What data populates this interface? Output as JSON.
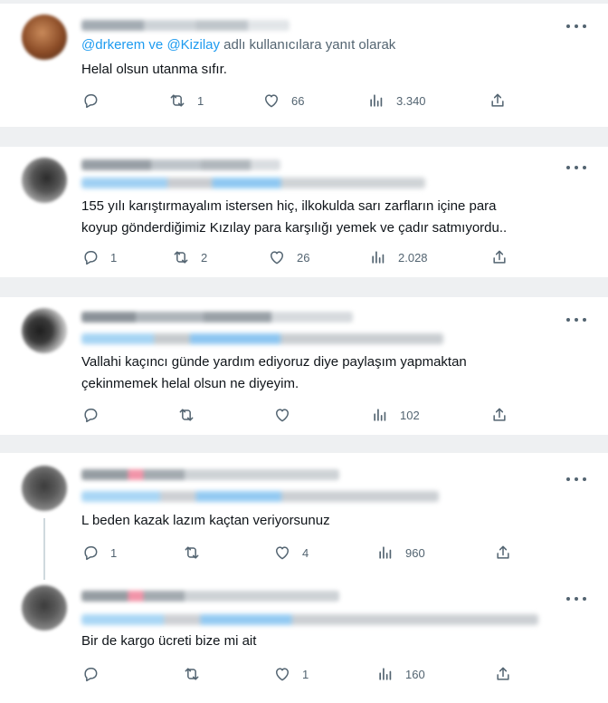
{
  "tweets": [
    {
      "reply_prefix_mention1": "@drkerem",
      "reply_and": " ve ",
      "reply_prefix_mention2": "@Kizilay",
      "reply_suffix": " adlı kullanıcılara yanıt olarak",
      "text_lines": [
        "Helal olsun utanma sıfır."
      ],
      "reply_count": "",
      "retweet_count": "1",
      "like_count": "66",
      "view_count": "3.340"
    },
    {
      "text_lines": [
        "155 yılı karıştırmayalım istersen hiç, ilkokulda sarı zarfların içine para",
        "koyup gönderdiğimiz Kızılay para karşılığı yemek ve çadır satmıyordu.."
      ],
      "reply_count": "1",
      "retweet_count": "2",
      "like_count": "26",
      "view_count": "2.028"
    },
    {
      "text_lines": [
        "Vallahi kaçıncı günde yardım ediyoruz diye paylaşım yapmaktan",
        "çekinmemek helal olsun ne diyeyim."
      ],
      "reply_count": "",
      "retweet_count": "",
      "like_count": "",
      "view_count": "102"
    },
    {
      "text_lines": [
        "L beden kazak lazım kaçtan veriyorsunuz"
      ],
      "reply_count": "1",
      "retweet_count": "",
      "like_count": "4",
      "view_count": "960"
    },
    {
      "text_lines": [
        "Bir de kargo ücreti bize mi ait"
      ],
      "reply_count": "",
      "retweet_count": "",
      "like_count": "1",
      "view_count": "160"
    }
  ],
  "icons": {
    "reply": "reply-icon",
    "retweet": "retweet-icon",
    "like": "like-icon",
    "views": "views-icon",
    "share": "share-icon",
    "more": "more-icon"
  },
  "colors": {
    "link": "#1d9bf0",
    "secondary_text": "#536471",
    "separator": "#eef0f2"
  }
}
